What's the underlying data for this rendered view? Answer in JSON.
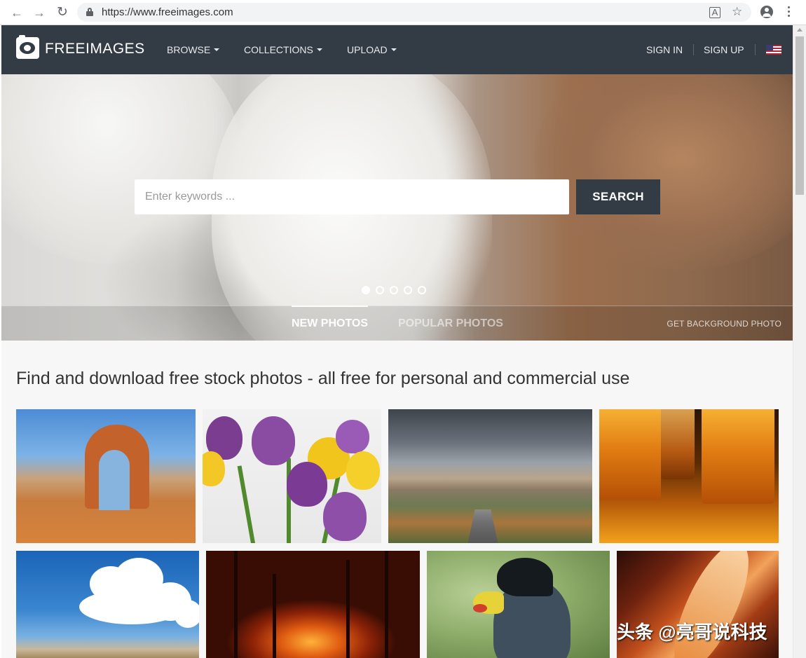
{
  "browser": {
    "url": "https://www.freeimages.com"
  },
  "header": {
    "logo_text": "FREEIMAGES",
    "nav": [
      {
        "label": "BROWSE"
      },
      {
        "label": "COLLECTIONS"
      },
      {
        "label": "UPLOAD"
      }
    ],
    "sign_in": "SIGN IN",
    "sign_up": "SIGN UP",
    "locale_icon": "us-flag-icon"
  },
  "hero": {
    "search_placeholder": "Enter keywords ...",
    "search_button": "SEARCH",
    "slides_total": 5,
    "active_slide": 1,
    "tabs": [
      {
        "label": "NEW PHOTOS",
        "active": true
      },
      {
        "label": "POPULAR PHOTOS",
        "active": false
      }
    ],
    "background_link": "GET BACKGROUND PHOTO"
  },
  "main": {
    "headline": "Find and download free stock photos - all free for personal and commercial use"
  },
  "watermark": "头条 @亮哥说科技",
  "colors": {
    "header_bg": "#333b44",
    "search_button_bg": "#333b44",
    "page_bg": "#f7f7f7"
  }
}
